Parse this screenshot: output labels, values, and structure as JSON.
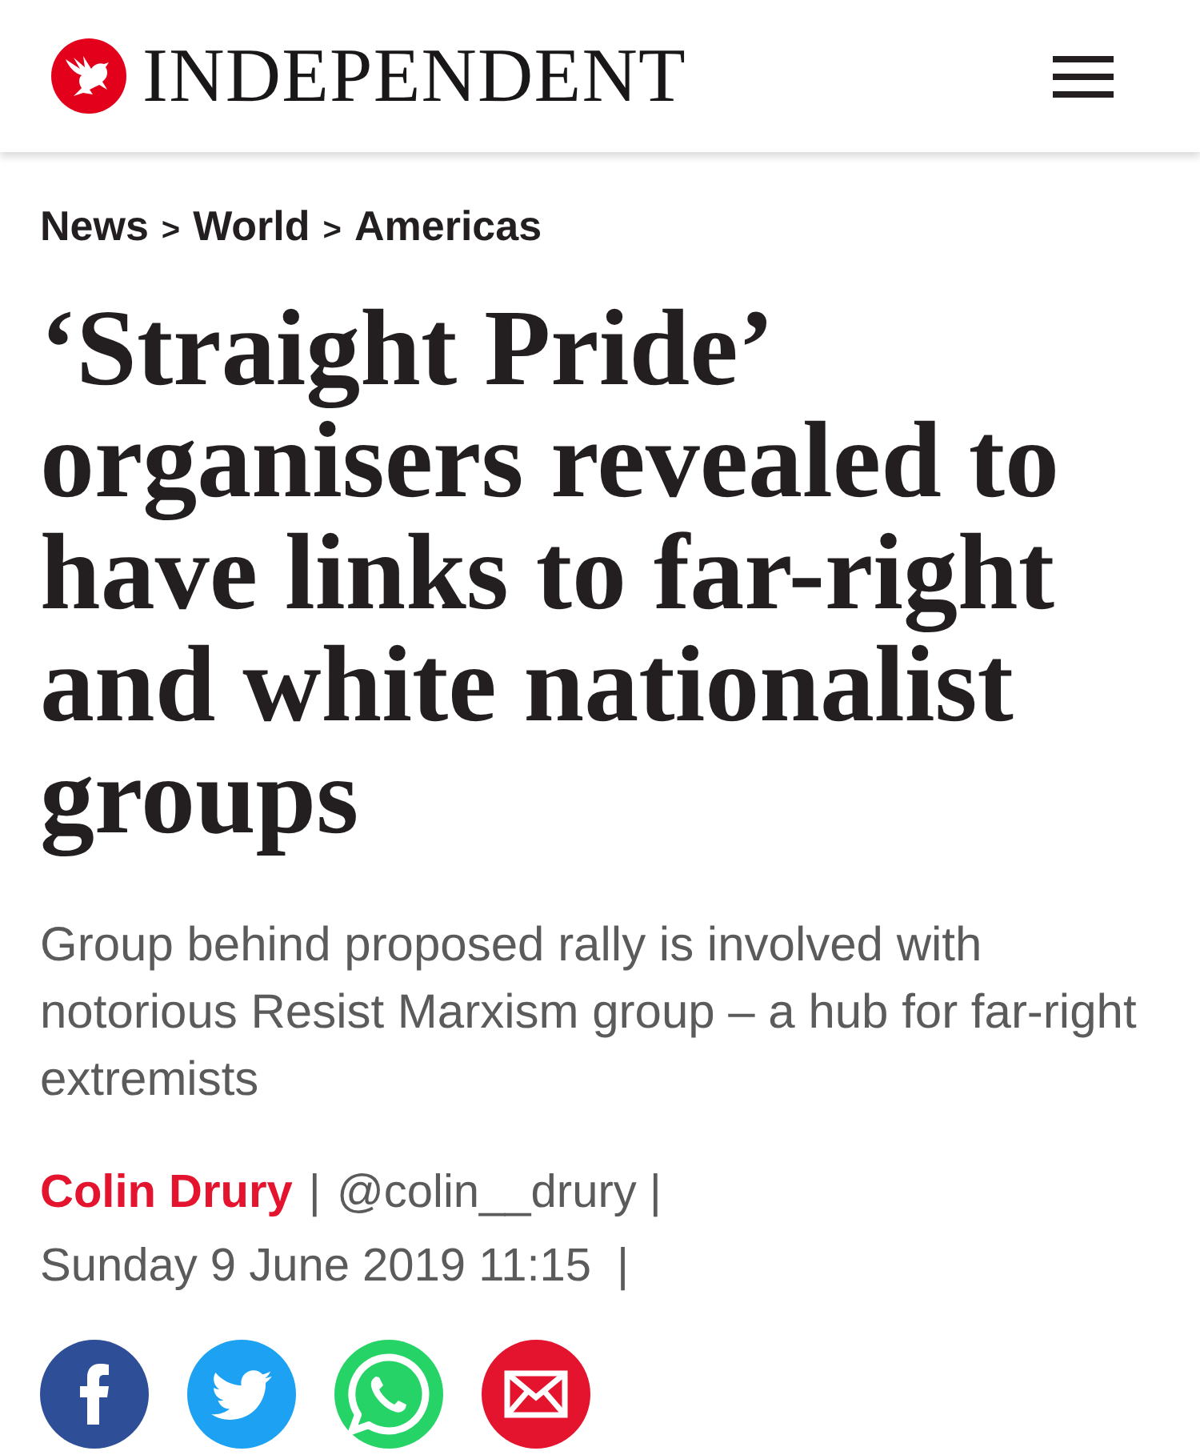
{
  "header": {
    "logo_text": "INDEPENDENT"
  },
  "breadcrumb": {
    "items": [
      "News",
      "World",
      "Americas"
    ],
    "separators": [
      ">",
      ">"
    ]
  },
  "headline": "‘Straight Pride’ organisers revealed to have links to far-right and white nationalist groups",
  "standfirst": "Group behind proposed rally is involved with notorious Resist Marxism group – a hub for far-right extremists",
  "byline": {
    "author": "Colin Drury",
    "divider_1": "|",
    "handle": "@colin__drury",
    "divider_2": "|"
  },
  "dateline": {
    "date": "Sunday 9 June 2019 11:15",
    "divider": "|"
  },
  "share_buttons": [
    {
      "kind": "facebook",
      "color": "#2f4e98"
    },
    {
      "kind": "twitter",
      "color": "#1da1f2"
    },
    {
      "kind": "whatsapp",
      "color": "#25d366"
    },
    {
      "kind": "email",
      "color": "#e4142e"
    }
  ]
}
